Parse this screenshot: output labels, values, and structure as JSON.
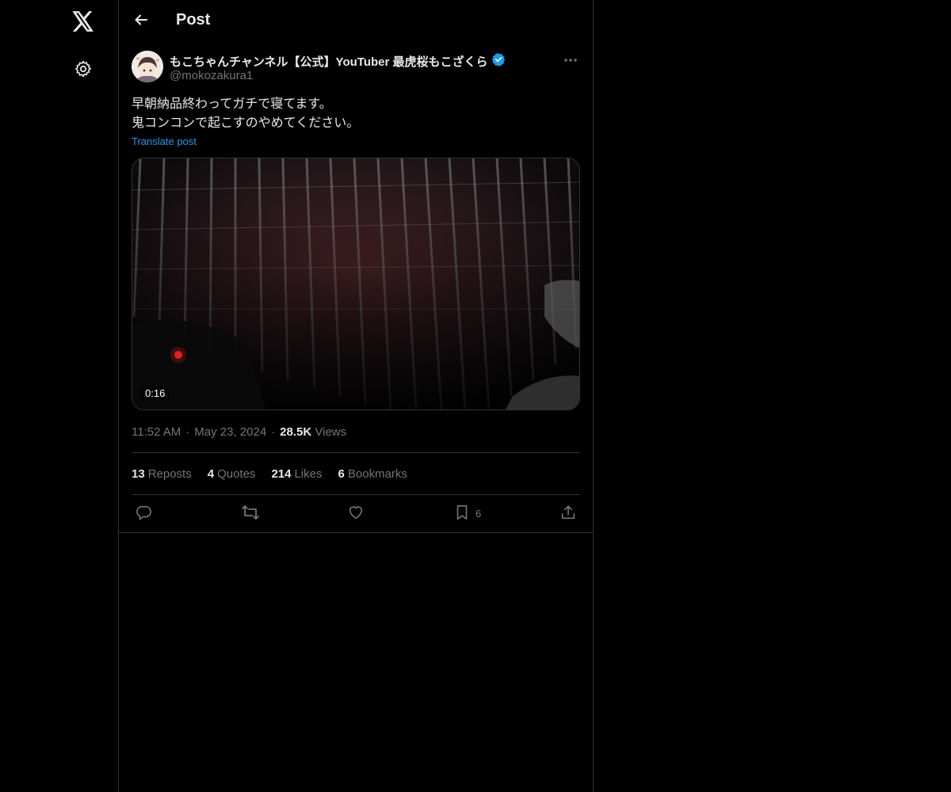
{
  "nav": {
    "logo_icon": "x-logo-icon",
    "settings_icon": "gear-icon"
  },
  "header": {
    "back_icon": "arrow-left-icon",
    "title": "Post"
  },
  "post": {
    "author": {
      "display_name": "もこちゃんチャンネル【公式】YouTuber 最虎桜もこざくら",
      "handle": "@mokozakura1",
      "verified": true,
      "verified_color": "#1d9bf0"
    },
    "text_lines": [
      "早朝納品終わってガチで寝てます。",
      "鬼コンコンで起こすのやめてください。"
    ],
    "translate_label": "Translate post",
    "video": {
      "duration": "0:16"
    },
    "time": "11:52 AM",
    "date": "May 23, 2024",
    "views_count": "28.5K",
    "views_label": "Views",
    "stats": [
      {
        "count": "13",
        "label": "Reposts"
      },
      {
        "count": "4",
        "label": "Quotes"
      },
      {
        "count": "214",
        "label": "Likes"
      },
      {
        "count": "6",
        "label": "Bookmarks"
      }
    ],
    "actions": {
      "reply_icon": "reply-icon",
      "repost_icon": "repost-icon",
      "like_icon": "heart-icon",
      "bookmark_icon": "bookmark-icon",
      "bookmark_count": "6",
      "share_icon": "share-icon"
    }
  },
  "colors": {
    "background": "#000000",
    "text_primary": "#e7e9ea",
    "text_secondary": "#71767b",
    "accent": "#1d9bf0",
    "border": "#2f3336"
  }
}
